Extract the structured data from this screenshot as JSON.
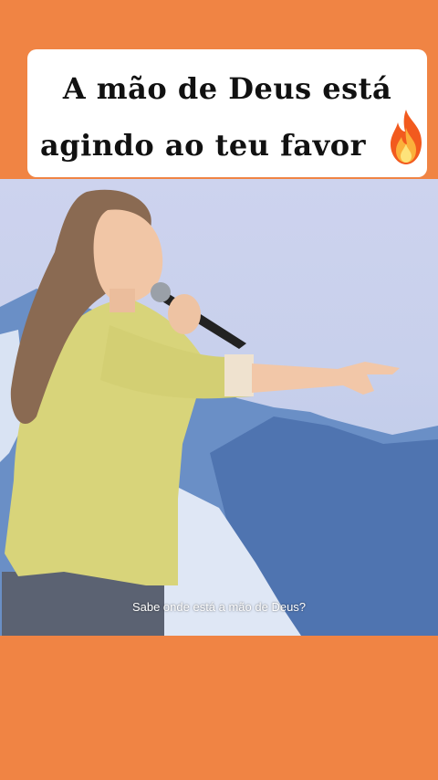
{
  "caption": {
    "line1": "A mão de Deus está",
    "line2": "agindo ao teu favor"
  },
  "icon": {
    "name": "fire-icon"
  },
  "video": {
    "subtitle": "Sabe onde está a mão de Deus?"
  },
  "colors": {
    "background": "#f08444",
    "caption_bg": "#ffffff",
    "jacket": "#d8d47a"
  }
}
